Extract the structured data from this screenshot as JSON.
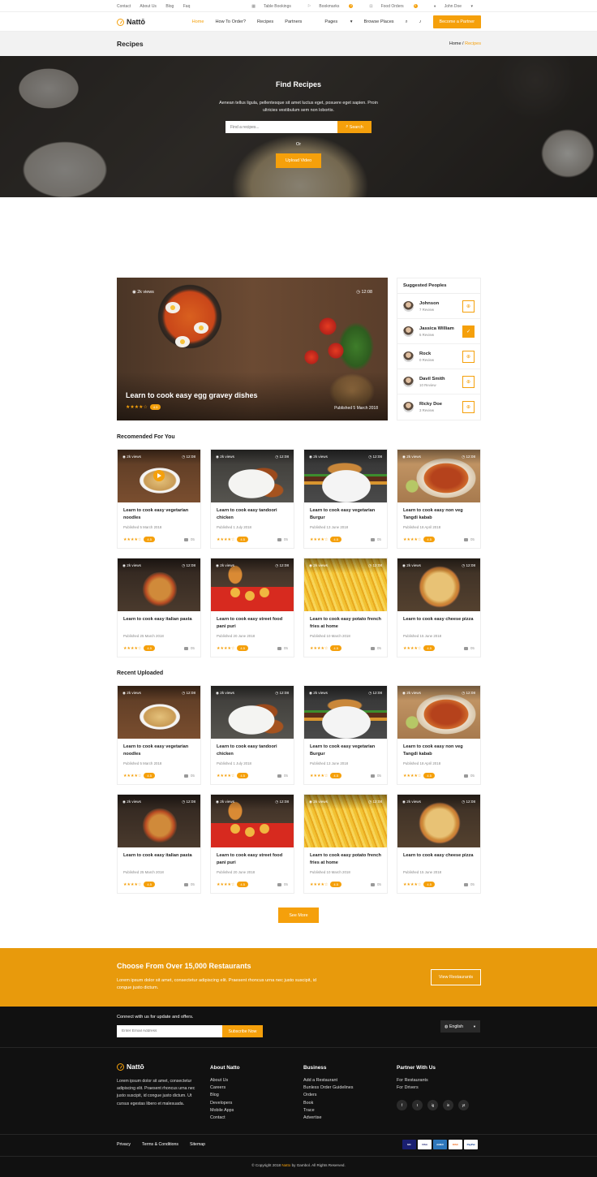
{
  "topbar": {
    "links": [
      "Contact",
      "About Us",
      "Blog",
      "Faq"
    ],
    "table_bookings": "Table Bookings",
    "bookmarks": "Bookmarks",
    "bookmarks_count": "0",
    "food_orders": "Food Orders",
    "food_orders_count": "0",
    "user": "John Doe"
  },
  "nav": {
    "brand": "Nattō",
    "items": [
      "Home",
      "How To Order?",
      "Recipes",
      "Partners",
      "Pages",
      "Browse Places"
    ],
    "partner_button": "Become a Partner",
    "accent": "#f5a00b"
  },
  "page_title": {
    "title": "Recipes",
    "crumb_home": "Home",
    "crumb_sep": " / ",
    "crumb_current": "Recipes"
  },
  "hero": {
    "title": "Find Recipes",
    "text": "Aenean tellus ligula, pellentesque sit amet luctus eget, posuere eget sapien. Proin ultricies vestibulum sem non lobortis.",
    "search_placeholder": "Find a recipes...",
    "search_button": "Search",
    "or": "Or",
    "upload_button": "Upload Video"
  },
  "featured": {
    "views": "2k views",
    "time": "12:08",
    "title": "Learn to cook easy egg gravey dishes",
    "stars": "★★★★☆",
    "rating": "4.5",
    "published": "Published 5 March 2018"
  },
  "suggested": {
    "title": "Suggested Peoples",
    "people": [
      {
        "name": "Johnson",
        "reviews": "7 Review",
        "following": false
      },
      {
        "name": "Jassica William",
        "reviews": "5 Review",
        "following": true
      },
      {
        "name": "Rock",
        "reviews": "0 Review",
        "following": false
      },
      {
        "name": "Davil Smith",
        "reviews": "10 Review",
        "following": false
      },
      {
        "name": "Ricky Doe",
        "reviews": "3 Review",
        "following": false
      }
    ]
  },
  "recommended": {
    "title": "Recomended For You",
    "cards": [
      {
        "title": "Learn to cook easy vegetarian noodles",
        "published": "Published 5 March 2018",
        "views": "2k views",
        "time": "12:08",
        "stars": "★★★★☆",
        "rating": "4.5",
        "comments": "05"
      },
      {
        "title": "Learn to cook easy tandoori chicken",
        "published": "Published 1 July 2018",
        "views": "2k views",
        "time": "12:08",
        "stars": "★★★★☆",
        "rating": "4.5",
        "comments": "05"
      },
      {
        "title": "Learn to cook easy vegetarian Burgur",
        "published": "Published 13 June 2018",
        "views": "2k views",
        "time": "12:08",
        "stars": "★★★★☆",
        "rating": "4.5",
        "comments": "05"
      },
      {
        "title": "Learn to cook easy non veg Tangdi kabab",
        "published": "Published 18 April 2018",
        "views": "2k views",
        "time": "12:08",
        "stars": "★★★★☆",
        "rating": "4.5",
        "comments": "05"
      },
      {
        "title": "Learn to cook easy italian pasta",
        "published": "Published 25 March 2018",
        "views": "2k views",
        "time": "12:08",
        "stars": "★★★★☆",
        "rating": "4.5",
        "comments": "05"
      },
      {
        "title": "Learn to cook easy street food pani puri",
        "published": "Published 20 June 2018",
        "views": "2k views",
        "time": "12:08",
        "stars": "★★★★☆",
        "rating": "4.5",
        "comments": "05"
      },
      {
        "title": "Learn to cook easy potato french fries at home",
        "published": "Published 10 March 2018",
        "views": "2k views",
        "time": "12:08",
        "stars": "★★★★☆",
        "rating": "4.5",
        "comments": "05"
      },
      {
        "title": "Learn to cook easy cheese pizza",
        "published": "Published 15 June 2018",
        "views": "2k views",
        "time": "12:08",
        "stars": "★★★★☆",
        "rating": "4.5",
        "comments": "05"
      }
    ]
  },
  "recent": {
    "title": "Recent Uploaded",
    "cards": [
      {
        "title": "Learn to cook easy vegetarian noodles",
        "published": "Published 5 March 2018",
        "views": "2k views",
        "time": "12:08",
        "stars": "★★★★☆",
        "rating": "4.5",
        "comments": "05"
      },
      {
        "title": "Learn to cook easy tandoori chicken",
        "published": "Published 1 July 2018",
        "views": "2k views",
        "time": "12:08",
        "stars": "★★★★☆",
        "rating": "4.5",
        "comments": "05"
      },
      {
        "title": "Learn to cook easy vegetarian Burgur",
        "published": "Published 13 June 2018",
        "views": "2k views",
        "time": "12:08",
        "stars": "★★★★☆",
        "rating": "4.5",
        "comments": "05"
      },
      {
        "title": "Learn to cook easy non veg Tangdi kabab",
        "published": "Published 18 April 2018",
        "views": "2k views",
        "time": "12:08",
        "stars": "★★★★☆",
        "rating": "4.5",
        "comments": "05"
      },
      {
        "title": "Learn to cook easy italian pasta",
        "published": "Published 25 March 2018",
        "views": "2k views",
        "time": "12:08",
        "stars": "★★★★☆",
        "rating": "4.5",
        "comments": "05"
      },
      {
        "title": "Learn to cook easy street food pani puri",
        "published": "Published 20 June 2018",
        "views": "2k views",
        "time": "12:08",
        "stars": "★★★★☆",
        "rating": "4.5",
        "comments": "05"
      },
      {
        "title": "Learn to cook easy potato french fries at home",
        "published": "Published 10 March 2018",
        "views": "2k views",
        "time": "12:08",
        "stars": "★★★★☆",
        "rating": "4.5",
        "comments": "05"
      },
      {
        "title": "Learn to cook easy cheese pizza",
        "published": "Published 15 June 2018",
        "views": "2k views",
        "time": "12:08",
        "stars": "★★★★☆",
        "rating": "4.5",
        "comments": "05"
      }
    ]
  },
  "see_more": "See More",
  "banner": {
    "title": "Choose From Over 15,000 Restaurants",
    "text": "Lorem ipsum dolor sit amet, consectetur adipiscing elit. Praesent rhoncus urna nec justo suscipit, id congue justo dictum.",
    "button": "View Restaurants",
    "color": "#e89a0c"
  },
  "footer": {
    "newsletter_title": "Connect with us for update and offers.",
    "email_placeholder": "Enter Email Address",
    "subscribe": "Subscribe Now",
    "language": "English",
    "brand": "Nattō",
    "about_text": "Lorem ipsum dolor sit amet, consectetur adipiscing elit. Praesent rhoncus urna nec justo suscipit, id congue justo dictum. Ut cursus egestas libero et malesuada.",
    "col_about": {
      "title": "About Natto",
      "links": [
        "About Us",
        "Careers",
        "Blog",
        "Developers",
        "Mobile Apps",
        "Contact"
      ]
    },
    "col_business": {
      "title": "Business",
      "links": [
        "Add a Restaurant",
        "Bunless Order Guidelines",
        "Orders",
        "Book",
        "Trace",
        "Advertise"
      ]
    },
    "col_partner": {
      "title": "Partner With Us",
      "links": [
        "For Restaurants",
        "For Drivers"
      ]
    },
    "social": [
      "f",
      "t",
      "ig",
      "in",
      "yt"
    ],
    "bottom_links": [
      "Privacy",
      "Terms & Conditions",
      "Sitemap"
    ],
    "payments": [
      "MC",
      "VISA",
      "AMEX",
      "DISC",
      "PayPal"
    ],
    "copyright_pre": "© Copyright 2018 ",
    "copyright_brand": "Natto",
    "copyright_post": " by Gambol. All Rights Reserved."
  }
}
